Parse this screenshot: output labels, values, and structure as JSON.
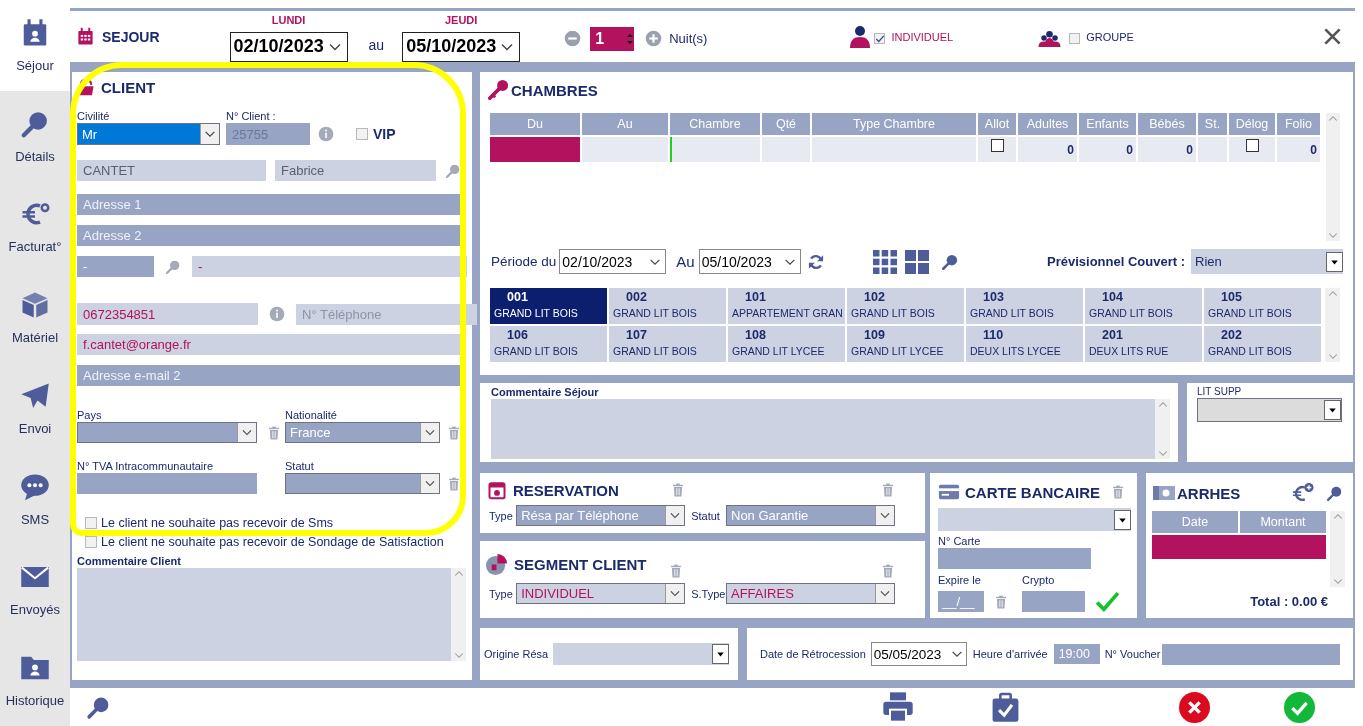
{
  "sidebar": {
    "items": [
      {
        "label": "Séjour",
        "selected": true
      },
      {
        "label": "Détails",
        "selected": false
      },
      {
        "label": "Facturat°",
        "selected": false
      },
      {
        "label": "Matériel",
        "selected": false
      },
      {
        "label": "Envoi",
        "selected": false
      },
      {
        "label": "SMS",
        "selected": false
      },
      {
        "label": "Envoyés",
        "selected": false
      },
      {
        "label": "Historique",
        "selected": false
      }
    ]
  },
  "header": {
    "title": "SEJOUR",
    "arrival_day": "LUNDI",
    "arrival": "02/10/2023",
    "to": "au",
    "departure_day": "JEUDI",
    "departure": "05/10/2023",
    "nights": "1",
    "nights_label": "Nuit(s)",
    "modes": [
      {
        "label": "INDIVIDUEL",
        "checked": true
      },
      {
        "label": "GROUPE",
        "checked": false
      }
    ]
  },
  "client": {
    "title": "CLIENT",
    "civility_label": "Civilité",
    "civility": "Mr",
    "client_no_label": "N° Client :",
    "client_no": "25755",
    "vip_label": "VIP",
    "vip": false,
    "last_name": "CANTET",
    "first_name": "Fabrice",
    "address1_placeholder": "Adresse 1",
    "address2_placeholder": "Adresse 2",
    "postcode": "-",
    "city": "-",
    "mobile": "0672354851",
    "phone_placeholder": "N° Téléphone",
    "email": "f.cantet@orange.fr",
    "email2_placeholder": "Adresse e-mail 2",
    "country_label": "Pays",
    "nationality_label": "Nationalité",
    "nationality": "France",
    "vat_label": "N° TVA Intracommunautaire",
    "status_label": "Statut",
    "options": [
      {
        "label": "Le client ne souhaite pas recevoir de Sms",
        "checked": false
      },
      {
        "label": "Le client ne souhaite pas recevoir de Sondage de Satisfaction",
        "checked": false
      }
    ],
    "comment_label": "Commentaire Client"
  },
  "rooms": {
    "title": "CHAMBRES",
    "table": {
      "columns": [
        "Du",
        "Au",
        "Chambre",
        "Qté",
        "Type Chambre",
        "Allot",
        "Adultes",
        "Enfants",
        "Bébés",
        "St.",
        "Délog",
        "Folio"
      ],
      "rows": [
        {
          "allot": false,
          "adultes": "0",
          "enfants": "0",
          "bebes": "0",
          "delog": false,
          "folio": "0"
        }
      ]
    },
    "period_label": "Période du",
    "period_from": "02/10/2023",
    "period_to_label": "Au",
    "period_to": "05/10/2023",
    "couvert_label": "Prévisionnel Couvert :",
    "couvert": "Rien",
    "grid": [
      {
        "number": "001",
        "type": "GRAND LIT BOIS",
        "selected": true
      },
      {
        "number": "002",
        "type": "GRAND LIT BOIS",
        "selected": false
      },
      {
        "number": "101",
        "type": "APPARTEMENT GRAN",
        "selected": false
      },
      {
        "number": "102",
        "type": "GRAND LIT BOIS",
        "selected": false
      },
      {
        "number": "103",
        "type": "GRAND LIT BOIS",
        "selected": false
      },
      {
        "number": "104",
        "type": "GRAND LIT BOIS",
        "selected": false
      },
      {
        "number": "105",
        "type": "GRAND LIT BOIS",
        "selected": false
      },
      {
        "number": "106",
        "type": "GRAND LIT BOIS",
        "selected": false
      },
      {
        "number": "107",
        "type": "GRAND LIT BOIS",
        "selected": false
      },
      {
        "number": "108",
        "type": "GRAND LIT LYCEE",
        "selected": false
      },
      {
        "number": "109",
        "type": "GRAND LIT LYCEE",
        "selected": false
      },
      {
        "number": "110",
        "type": "DEUX LITS LYCEE",
        "selected": false
      },
      {
        "number": "201",
        "type": "DEUX LITS RUE",
        "selected": false
      },
      {
        "number": "202",
        "type": "GRAND LIT BOIS",
        "selected": false
      }
    ]
  },
  "stay_comment": {
    "label": "Commentaire Séjour"
  },
  "extra_bed": {
    "label": "LIT SUPP"
  },
  "reservation": {
    "title": "RESERVATION",
    "type_label": "Type",
    "type": "Résa par Téléphone",
    "status_label": "Statut",
    "status": "Non Garantie"
  },
  "segment": {
    "title": "SEGMENT CLIENT",
    "type_label": "Type",
    "type": "INDIVIDUEL",
    "subtype_label": "S.Type",
    "subtype": "AFFAIRES"
  },
  "card": {
    "title": "CARTE BANCAIRE",
    "number_label": "N° Carte",
    "expiry_label": "Expire le",
    "expiry": "__/__",
    "crypto_label": "Crypto"
  },
  "deposit": {
    "title": "ARRHES",
    "columns": [
      "Date",
      "Montant"
    ],
    "total": "Total : 0.00 €"
  },
  "origin": {
    "label": "Origine Résa"
  },
  "retrocession": {
    "label": "Date de Rétrocession",
    "date": "05/05/2023",
    "arrival_label": "Heure d'arrivée",
    "arrival_time": "19:00",
    "voucher_label": "N° Voucher"
  }
}
